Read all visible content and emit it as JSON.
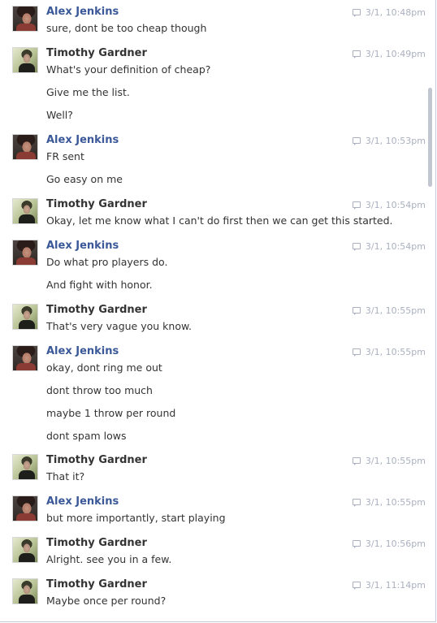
{
  "conversation": [
    {
      "sender": "Alex Jenkins",
      "avatar": "alex",
      "timestamp": "3/1, 10:48pm",
      "lines": [
        "sure, dont be too cheap though"
      ]
    },
    {
      "sender": "Timothy Gardner",
      "avatar": "tim",
      "timestamp": "3/1, 10:49pm",
      "lines": [
        "What's your definition of cheap?",
        "Give me the list.",
        "Well?"
      ]
    },
    {
      "sender": "Alex Jenkins",
      "avatar": "alex",
      "timestamp": "3/1, 10:53pm",
      "lines": [
        "FR sent",
        "Go easy on me"
      ]
    },
    {
      "sender": "Timothy Gardner",
      "avatar": "tim",
      "timestamp": "3/1, 10:54pm",
      "lines": [
        "Okay, let me know what I can't do first then we can get this started."
      ]
    },
    {
      "sender": "Alex Jenkins",
      "avatar": "alex",
      "timestamp": "3/1, 10:54pm",
      "lines": [
        "Do what pro players do.",
        "And fight with honor."
      ]
    },
    {
      "sender": "Timothy Gardner",
      "avatar": "tim",
      "timestamp": "3/1, 10:55pm",
      "lines": [
        "That's very vague you know."
      ]
    },
    {
      "sender": "Alex Jenkins",
      "avatar": "alex",
      "timestamp": "3/1, 10:55pm",
      "lines": [
        "okay, dont ring me out",
        "dont throw too much",
        "maybe 1 throw per round",
        "dont spam lows"
      ]
    },
    {
      "sender": "Timothy Gardner",
      "avatar": "tim",
      "timestamp": "3/1, 10:55pm",
      "lines": [
        "That it?"
      ]
    },
    {
      "sender": "Alex Jenkins",
      "avatar": "alex",
      "timestamp": "3/1, 10:55pm",
      "lines": [
        "but more importantly, start playing"
      ]
    },
    {
      "sender": "Timothy Gardner",
      "avatar": "tim",
      "timestamp": "3/1, 10:56pm",
      "lines": [
        "Alright. see you in a few."
      ]
    },
    {
      "sender": "Timothy Gardner",
      "avatar": "tim",
      "timestamp": "3/1, 11:14pm",
      "lines": [
        "Maybe once per round?"
      ]
    }
  ],
  "colors": {
    "alex_name": "#3b5998",
    "tim_name": "#333333",
    "timestamp": "#aab0bf"
  }
}
